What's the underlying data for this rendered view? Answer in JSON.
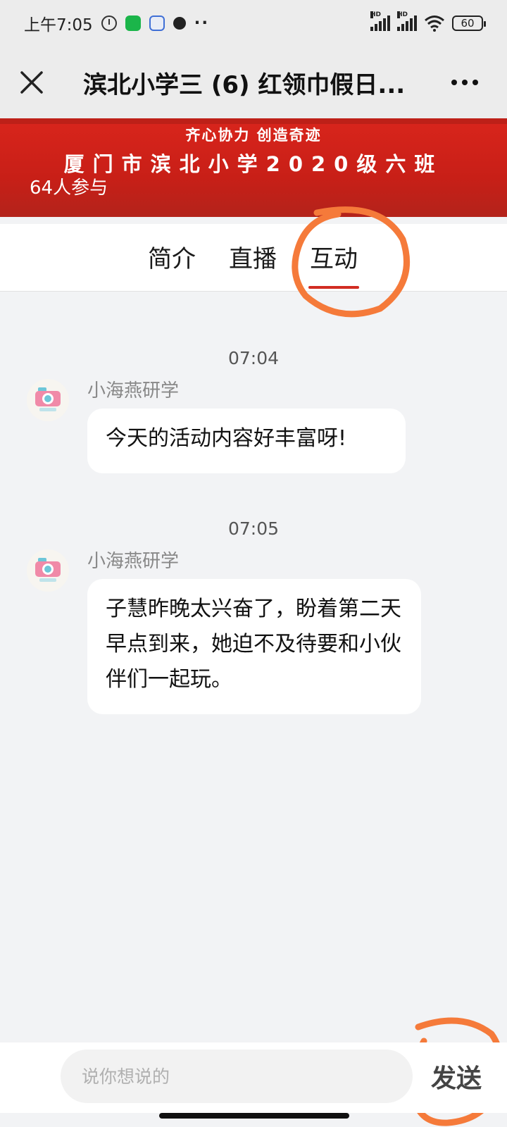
{
  "status_bar": {
    "time": "上午7:05",
    "more": "··",
    "battery": "60",
    "hd1": "HD",
    "hd2": "HD"
  },
  "header": {
    "title": "滨北小学三 (6) 红领巾假日..."
  },
  "banner": {
    "slogan": "齐心协力 创造奇迹",
    "school": "厦门市滨北小学2020级六班",
    "participants": "64人参与"
  },
  "tabs": [
    {
      "label": "简介"
    },
    {
      "label": "直播"
    },
    {
      "label": "互动",
      "active": true
    }
  ],
  "messages": [
    {
      "time": "07:04",
      "sender": "小海燕研学",
      "text": "今天的活动内容好丰富呀!"
    },
    {
      "time": "07:05",
      "sender": "小海燕研学",
      "text": "子慧昨晚太兴奋了，盼着第二天早点到来，她迫不及待要和小伙伴们一起玩。"
    }
  ],
  "composer": {
    "placeholder": "说你想说的",
    "value": "",
    "send_label": "发送"
  },
  "colors": {
    "accent": "#d22c22",
    "banner": "#c81f17",
    "annotation": "#f57a3a",
    "background": "#f2f3f5"
  },
  "icons": {
    "close": "close-icon",
    "more": "more-icon",
    "avatar": "camera-icon"
  }
}
